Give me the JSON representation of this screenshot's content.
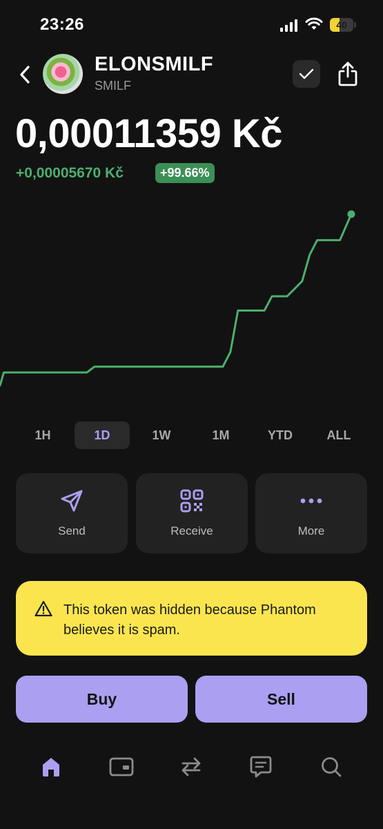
{
  "status_bar": {
    "time": "23:26",
    "battery_level": "40",
    "battery_fraction": 0.4,
    "battery_color": "#f2d332"
  },
  "header": {
    "back_icon": "chevron-left-icon",
    "token_name": "ELONSMILF",
    "token_symbol": "SMILF",
    "check_icon": "checkmark-icon",
    "share_icon": "share-icon"
  },
  "price": {
    "value": "0,00011359 Kč",
    "change_amount": "+0,00005670 Kč",
    "change_percent": "+99.66%",
    "positive_color": "#4caf6e"
  },
  "chart_data": {
    "type": "line",
    "title": "",
    "xlabel": "",
    "ylabel": "",
    "grid": false,
    "series": [
      {
        "color": "#4caf6e",
        "x": [
          0,
          1,
          3,
          23,
          25,
          59,
          61,
          63,
          70,
          72,
          76,
          80,
          82,
          84,
          90,
          93
        ],
        "y": [
          5.689e-05,
          6.12e-05,
          6.12e-05,
          6.12e-05,
          6.31e-05,
          6.31e-05,
          6.8e-05,
          8.17e-05,
          8.17e-05,
          8.64e-05,
          8.64e-05,
          9.14e-05,
          0.0001002,
          0.000105,
          0.000105,
          0.00011359
        ]
      }
    ]
  },
  "timeframes": {
    "items": [
      "1H",
      "1D",
      "1W",
      "1M",
      "YTD",
      "ALL"
    ],
    "selected": "1D"
  },
  "actions": {
    "send": {
      "label": "Send",
      "icon": "send-icon"
    },
    "receive": {
      "label": "Receive",
      "icon": "qr-code-icon"
    },
    "more": {
      "label": "More",
      "icon": "more-dots-icon"
    }
  },
  "warning": {
    "icon": "warning-triangle-icon",
    "text": "This token was hidden because Phantom believes it is spam.",
    "background": "#fbe54f"
  },
  "trade": {
    "buy_label": "Buy",
    "sell_label": "Sell",
    "accent_color": "#ab9ff2"
  },
  "nav": {
    "items": [
      {
        "icon": "home-icon",
        "active": true
      },
      {
        "icon": "wallet-card-icon",
        "active": false
      },
      {
        "icon": "swap-icon",
        "active": false
      },
      {
        "icon": "chat-icon",
        "active": false
      },
      {
        "icon": "search-icon",
        "active": false
      }
    ]
  }
}
